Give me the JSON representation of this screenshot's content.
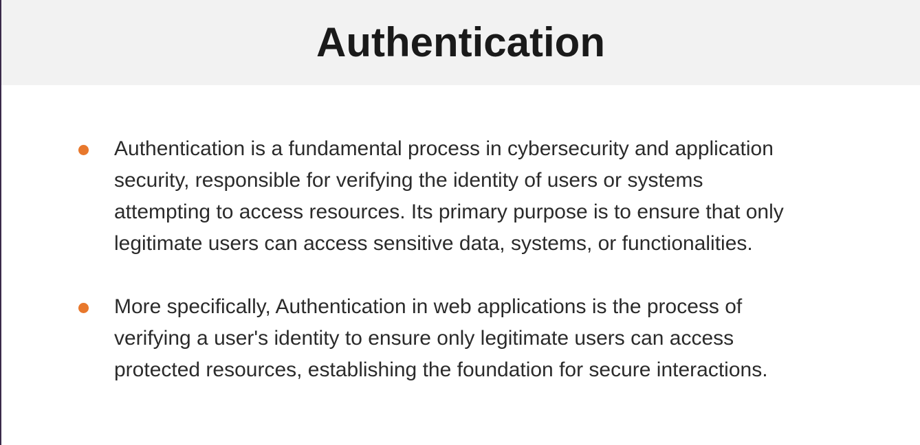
{
  "slide": {
    "title": "Authentication",
    "bullets": [
      {
        "text": "Authentication is a fundamental process in cybersecurity and application\nsecurity, responsible for verifying the identity of users or systems\nattempting to access resources. Its primary purpose is to ensure that only\nlegitimate users can access sensitive data, systems, or functionalities."
      },
      {
        "text": "More specifically, Authentication in web applications is the process of\nverifying a user's identity to ensure only legitimate users can access\nprotected resources, establishing the foundation for secure interactions."
      }
    ]
  },
  "colors": {
    "title_bar_background": "#f2f2f2",
    "bullet_accent": "#e8782c",
    "title_text": "#1a1a1a",
    "body_text": "#2b2b2b"
  },
  "icons": {
    "bullet": "orange-dot-bullet-icon"
  }
}
